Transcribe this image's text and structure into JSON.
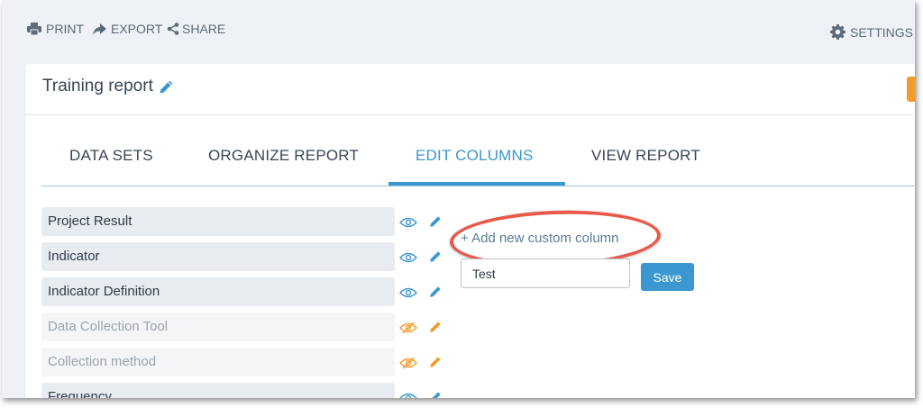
{
  "toolbar": {
    "print_label": "PRINT",
    "export_label": "EXPORT",
    "share_label": "SHARE",
    "settings_label": "SETTINGS"
  },
  "report": {
    "title": "Training report"
  },
  "tabs": [
    {
      "label": "DATA SETS",
      "active": false
    },
    {
      "label": "ORGANIZE REPORT",
      "active": false
    },
    {
      "label": "EDIT COLUMNS",
      "active": true
    },
    {
      "label": "VIEW REPORT",
      "active": false
    }
  ],
  "columns": [
    {
      "label": "Project Result",
      "visible": true
    },
    {
      "label": "Indicator",
      "visible": true
    },
    {
      "label": "Indicator Definition",
      "visible": true
    },
    {
      "label": "Data Collection Tool",
      "visible": false
    },
    {
      "label": "Collection method",
      "visible": false
    },
    {
      "label": "Frequency",
      "visible": true
    }
  ],
  "custom_column": {
    "add_label": "+ Add new custom column",
    "input_value": "Test",
    "save_label": "Save"
  },
  "colors": {
    "accent": "#3b97d0",
    "hidden_icon": "#f39c2c",
    "highlight_circle": "#e8594a"
  }
}
